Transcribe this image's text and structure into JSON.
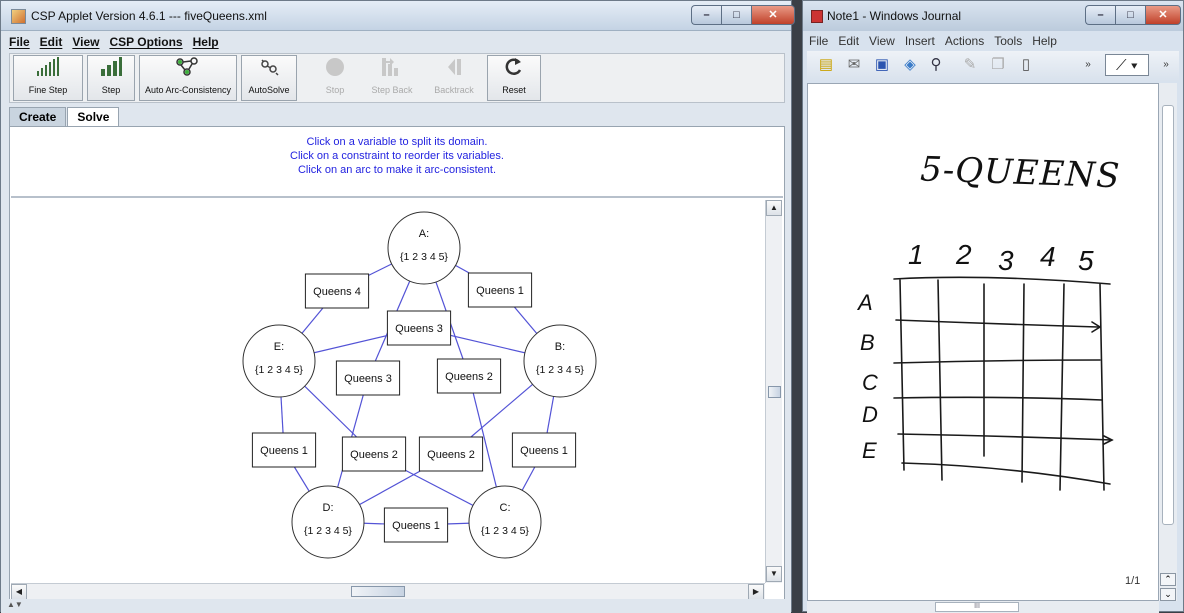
{
  "csp_window": {
    "title": "CSP Applet Version 4.6.1 --- fiveQueens.xml",
    "window_buttons": {
      "minimize": "–",
      "maximize": "□",
      "close": "✕"
    },
    "menu": [
      "File",
      "Edit",
      "View",
      "CSP Options",
      "Help"
    ],
    "toolbar": [
      {
        "label": "Fine Step",
        "icon": "fine-step-icon",
        "enabled": true
      },
      {
        "label": "Step",
        "icon": "step-icon",
        "enabled": true
      },
      {
        "label": "Auto Arc-Consistency",
        "icon": "auto-arc-icon",
        "enabled": true
      },
      {
        "label": "AutoSolve",
        "icon": "autosolve-icon",
        "enabled": true
      },
      {
        "label": "Stop",
        "icon": "stop-icon",
        "enabled": false
      },
      {
        "label": "Step Back",
        "icon": "step-back-icon",
        "enabled": false
      },
      {
        "label": "Backtrack",
        "icon": "backtrack-icon",
        "enabled": false
      },
      {
        "label": "Reset",
        "icon": "reset-icon",
        "enabled": true
      }
    ],
    "tabs": [
      {
        "label": "Create",
        "active": false
      },
      {
        "label": "Solve",
        "active": true
      }
    ],
    "instructions": [
      "Click on a variable to split its domain.",
      "Click on a constraint to reorder its variables.",
      "Click on an arc to make it arc-consistent."
    ],
    "graph": {
      "variables": [
        {
          "id": "A",
          "name": "A:",
          "domain": "{1 2 3 4 5}"
        },
        {
          "id": "B",
          "name": "B:",
          "domain": "{1 2 3 4 5}"
        },
        {
          "id": "C",
          "name": "C:",
          "domain": "{1 2 3 4 5}"
        },
        {
          "id": "D",
          "name": "D:",
          "domain": "{1 2 3 4 5}"
        },
        {
          "id": "E",
          "name": "E:",
          "domain": "{1 2 3 4 5}"
        }
      ],
      "constraints": [
        {
          "id": "AE",
          "label": "Queens 4",
          "vars": [
            "A",
            "E"
          ]
        },
        {
          "id": "AB",
          "label": "Queens 1",
          "vars": [
            "A",
            "B"
          ]
        },
        {
          "id": "EB",
          "label": "Queens 3",
          "vars": [
            "E",
            "B"
          ]
        },
        {
          "id": "AD",
          "label": "Queens 3",
          "vars": [
            "A",
            "D"
          ]
        },
        {
          "id": "AC",
          "label": "Queens 2",
          "vars": [
            "A",
            "C"
          ]
        },
        {
          "id": "ED",
          "label": "Queens 1",
          "vars": [
            "E",
            "D"
          ]
        },
        {
          "id": "EC",
          "label": "Queens 2",
          "vars": [
            "E",
            "C"
          ]
        },
        {
          "id": "BD",
          "label": "Queens 2",
          "vars": [
            "B",
            "D"
          ]
        },
        {
          "id": "BC",
          "label": "Queens 1",
          "vars": [
            "B",
            "C"
          ]
        },
        {
          "id": "DC",
          "label": "Queens 1",
          "vars": [
            "D",
            "C"
          ]
        }
      ]
    },
    "status": "▲▼"
  },
  "journal_window": {
    "title": "Note1 - Windows Journal",
    "menu": [
      "File",
      "Edit",
      "View",
      "Insert",
      "Actions",
      "Tools",
      "Help"
    ],
    "toolbar_icons": [
      "new-note-icon",
      "email-icon",
      "save-icon",
      "scan-icon",
      "find-icon",
      "pen-tool-icon",
      "copy-page-icon",
      "paste-icon"
    ],
    "note": {
      "heading": "5-QUEENS",
      "columns": [
        "1",
        "2",
        "3",
        "4",
        "5"
      ],
      "rows": [
        "A",
        "B",
        "C",
        "D",
        "E"
      ]
    },
    "page_indicator": "1/1",
    "overflow_glyph": "»",
    "hscroll_grip": "III"
  }
}
